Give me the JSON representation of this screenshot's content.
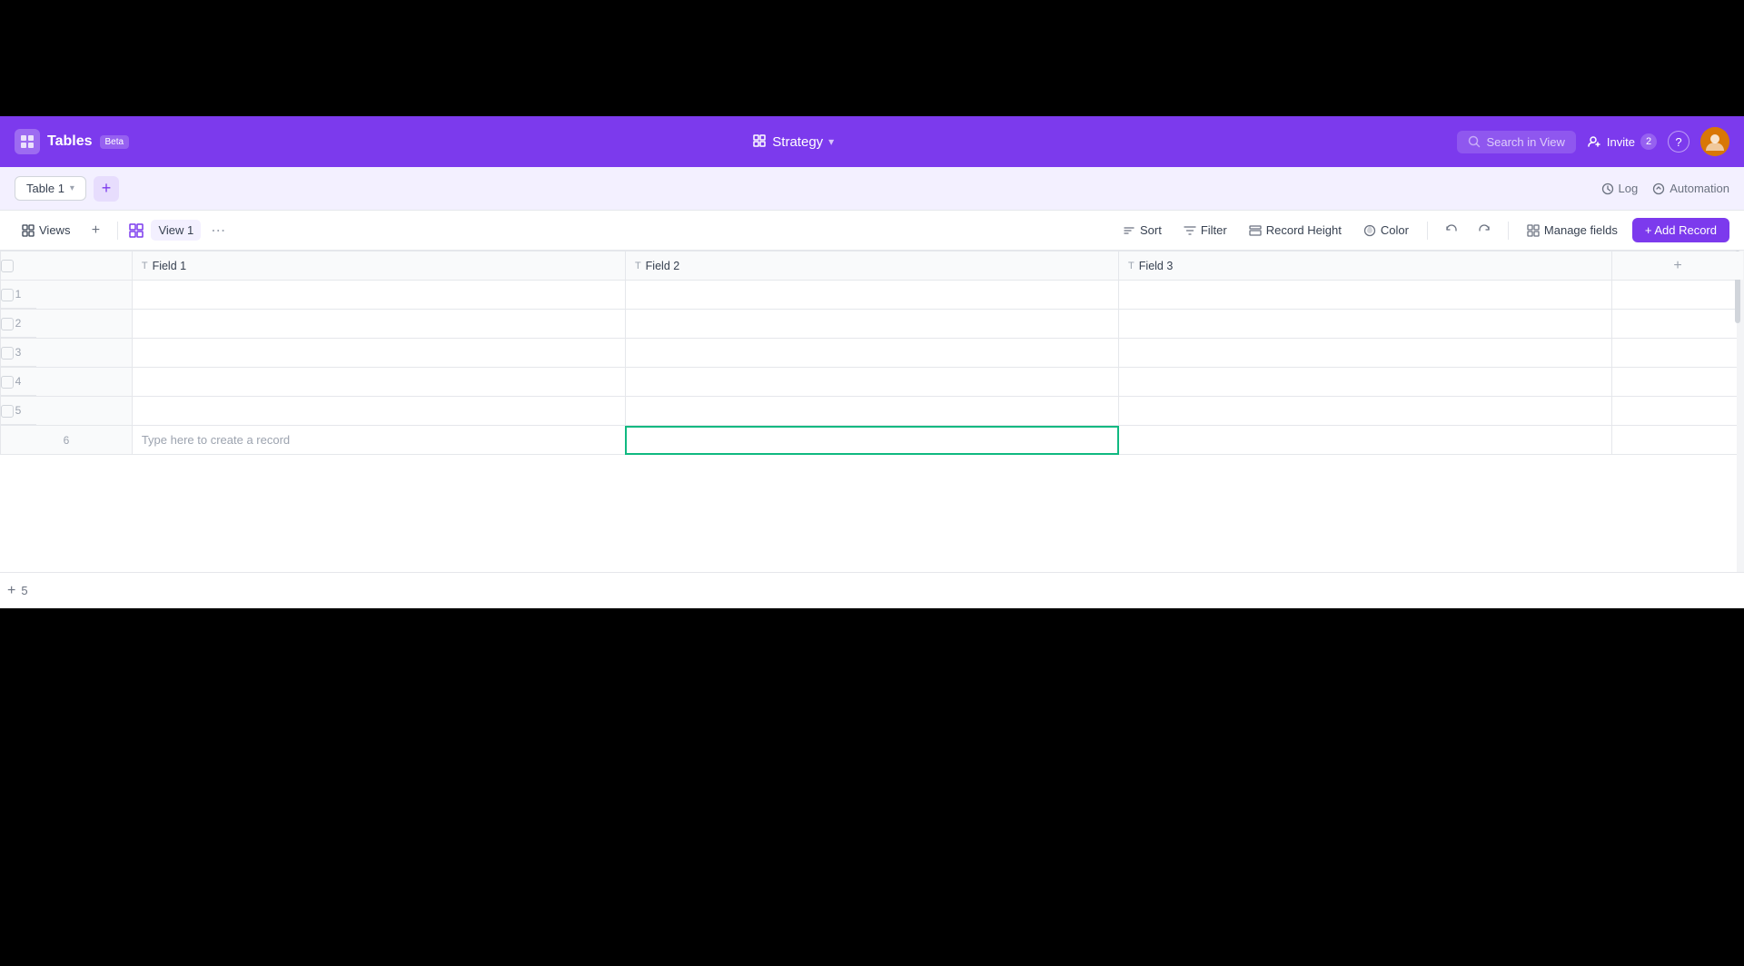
{
  "app": {
    "title": "Tables",
    "beta_label": "Beta",
    "logo_symbol": "⊞"
  },
  "header": {
    "project": "Strategy",
    "search_placeholder": "Search in View",
    "invite_label": "Invite",
    "invite_count": "2"
  },
  "tabs_bar": {
    "table1_label": "Table 1",
    "log_label": "Log",
    "automation_label": "Automation"
  },
  "toolbar": {
    "views_label": "Views",
    "add_view_tooltip": "+",
    "view1_label": "View 1",
    "sort_label": "Sort",
    "filter_label": "Filter",
    "record_height_label": "Record Height",
    "color_label": "Color",
    "manage_fields_label": "Manage fields",
    "add_record_label": "+ Add Record"
  },
  "table": {
    "columns": [
      {
        "id": "field1",
        "label": "Field 1",
        "type_icon": "T"
      },
      {
        "id": "field2",
        "label": "Field 2",
        "type_icon": "T"
      },
      {
        "id": "field3",
        "label": "Field 3",
        "type_icon": "T"
      }
    ],
    "rows": [
      {
        "num": 1,
        "cells": [
          "",
          "",
          ""
        ]
      },
      {
        "num": 2,
        "cells": [
          "",
          "",
          ""
        ]
      },
      {
        "num": 3,
        "cells": [
          "",
          "",
          ""
        ]
      },
      {
        "num": 4,
        "cells": [
          "",
          "",
          ""
        ]
      },
      {
        "num": 5,
        "cells": [
          "",
          "",
          ""
        ]
      }
    ],
    "placeholder_row": {
      "num": 6,
      "placeholder_text": "Type here to create a record"
    },
    "footer_add_label": "+",
    "footer_count": "5"
  }
}
